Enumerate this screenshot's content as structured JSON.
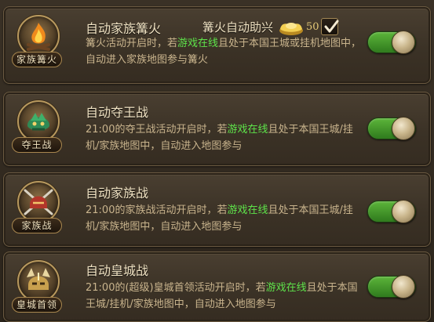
{
  "colors": {
    "highlight": "#5ee34a",
    "title": "#f1e3c3",
    "description": "#c9b48d",
    "toggle_on": "#5cb53a"
  },
  "items": [
    {
      "title": "自动家族篝火",
      "emblem_label": "家族篝火",
      "emblem_icon": "bonfire-icon",
      "desc_parts": [
        "篝火活动开启时，若",
        "游戏在线",
        "且处于本国王城或挂机地图中，自动进入家族地图参与篝火"
      ],
      "toggle_on": true,
      "assist": {
        "label": "篝火自动助兴",
        "icon": "gold-ingot-icon",
        "cost": "50",
        "checked": true
      }
    },
    {
      "title": "自动夺王战",
      "emblem_label": "夺王战",
      "emblem_icon": "dragon-helmet-icon",
      "desc_parts": [
        "21:00的夺王战活动开启时，若",
        "游戏在线",
        "且处于本国王城/挂机/家族地图中，自动进入地图参与"
      ],
      "toggle_on": true
    },
    {
      "title": "自动家族战",
      "emblem_label": "家族战",
      "emblem_icon": "crossed-swords-helmet-icon",
      "desc_parts": [
        "21:00的家族战活动开启时，若",
        "游戏在线",
        "且处于本国王城/挂机/家族地图中，自动进入地图参与"
      ],
      "toggle_on": true
    },
    {
      "title": "自动皇城战",
      "emblem_label": "皇城首领",
      "emblem_icon": "boss-helmet-icon",
      "desc_parts": [
        "21:00的(超级)皇城首领活动开启时，若",
        "游戏在线",
        "且处于本国王城/挂机/家族地图中，自动进入地图参与"
      ],
      "toggle_on": true
    }
  ]
}
